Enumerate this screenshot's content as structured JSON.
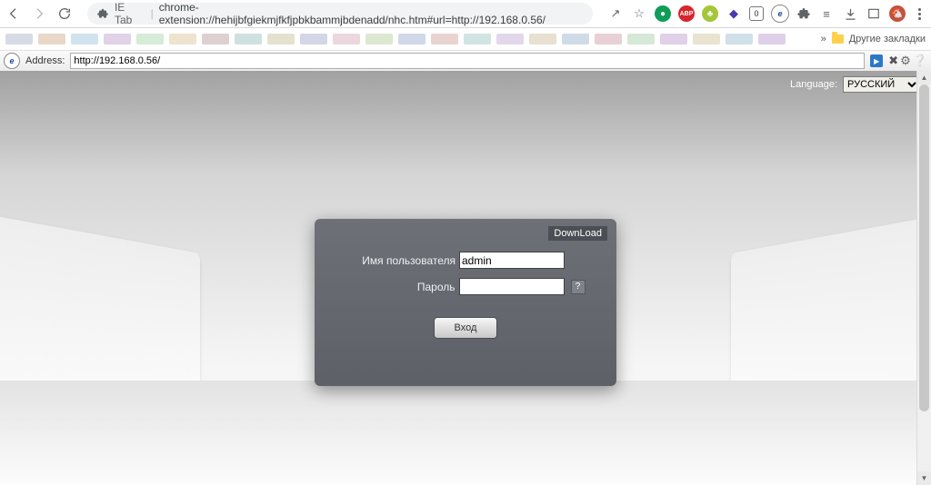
{
  "chrome": {
    "ext_name": "IE Tab",
    "url": "chrome-extension://hehijbfgiekmjfkfjpbkbammjbdenadd/nhc.htm#url=http://192.168.0.56/",
    "more_bookmarks": "»",
    "other_bookmarks": "Другие закладки",
    "icons": {
      "share": "↗",
      "star": "☆",
      "abp": "ABP",
      "hexo": "0"
    }
  },
  "ietab": {
    "addr_label": "Address:",
    "addr_value": "http://192.168.0.56/",
    "go": "▶"
  },
  "router": {
    "lang_label": "Language:",
    "lang_value": "РУССКИЙ",
    "download": "DownLoad",
    "user_label": "Имя пользователя",
    "user_value": "admin",
    "pass_label": "Пароль",
    "pass_value": "",
    "help": "?",
    "login_btn": "Вход"
  }
}
